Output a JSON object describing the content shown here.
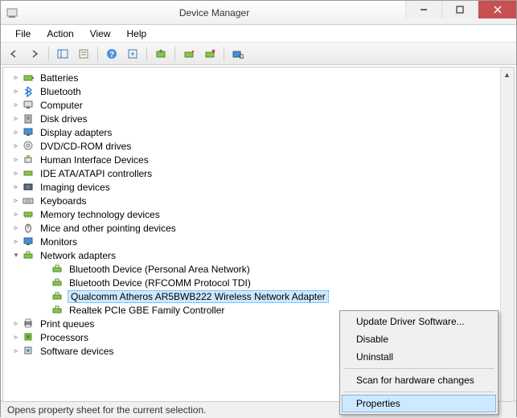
{
  "window": {
    "title": "Device Manager"
  },
  "menu": {
    "file": "File",
    "action": "Action",
    "view": "View",
    "help": "Help"
  },
  "tree": {
    "items": [
      {
        "label": "Batteries",
        "expanded": false,
        "icon": "battery"
      },
      {
        "label": "Bluetooth",
        "expanded": false,
        "icon": "bluetooth"
      },
      {
        "label": "Computer",
        "expanded": false,
        "icon": "computer"
      },
      {
        "label": "Disk drives",
        "expanded": false,
        "icon": "disk"
      },
      {
        "label": "Display adapters",
        "expanded": false,
        "icon": "display"
      },
      {
        "label": "DVD/CD-ROM drives",
        "expanded": false,
        "icon": "dvd"
      },
      {
        "label": "Human Interface Devices",
        "expanded": false,
        "icon": "hid"
      },
      {
        "label": "IDE ATA/ATAPI controllers",
        "expanded": false,
        "icon": "ide"
      },
      {
        "label": "Imaging devices",
        "expanded": false,
        "icon": "imaging"
      },
      {
        "label": "Keyboards",
        "expanded": false,
        "icon": "keyboard"
      },
      {
        "label": "Memory technology devices",
        "expanded": false,
        "icon": "memory"
      },
      {
        "label": "Mice and other pointing devices",
        "expanded": false,
        "icon": "mouse"
      },
      {
        "label": "Monitors",
        "expanded": false,
        "icon": "monitor"
      },
      {
        "label": "Network adapters",
        "expanded": true,
        "icon": "network",
        "children": [
          {
            "label": "Bluetooth Device (Personal Area Network)"
          },
          {
            "label": "Bluetooth Device (RFCOMM Protocol TDI)"
          },
          {
            "label": "Qualcomm Atheros AR5BWB222 Wireless Network Adapter",
            "selected": true
          },
          {
            "label": "Realtek PCIe GBE Family Controller"
          }
        ]
      },
      {
        "label": "Print queues",
        "expanded": false,
        "icon": "print"
      },
      {
        "label": "Processors",
        "expanded": false,
        "icon": "cpu"
      },
      {
        "label": "Software devices",
        "expanded": false,
        "icon": "software"
      }
    ]
  },
  "context_menu": {
    "update": "Update Driver Software...",
    "disable": "Disable",
    "uninstall": "Uninstall",
    "scan": "Scan for hardware changes",
    "properties": "Properties"
  },
  "status": {
    "text": "Opens property sheet for the current selection."
  }
}
